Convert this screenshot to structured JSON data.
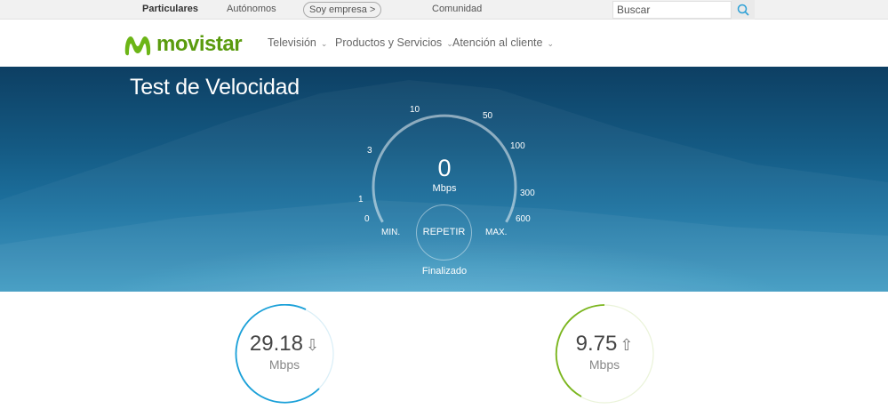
{
  "topbar": {
    "items": [
      "Particulares",
      "Autónomos",
      "Soy empresa >",
      "Comunidad"
    ],
    "search_placeholder": "Buscar"
  },
  "nav": {
    "brand": "movistar",
    "items": [
      "Televisión",
      "Productos y Servicios",
      "Atención al cliente"
    ]
  },
  "hero": {
    "title": "Test de Velocidad",
    "gauge_ticks": [
      "0",
      "1",
      "3",
      "10",
      "50",
      "100",
      "300",
      "600"
    ],
    "speed_value": "0",
    "speed_unit": "Mbps",
    "min_label": "MIN.",
    "max_label": "MAX.",
    "repeat_label": "REPETIR",
    "status": "Finalizado"
  },
  "results": {
    "download": {
      "value": "29.18",
      "unit": "Mbps",
      "icon": "download-arrow-icon",
      "color": "#1aa0d8"
    },
    "upload": {
      "value": "9.75",
      "unit": "Mbps",
      "icon": "upload-arrow-icon",
      "color": "#7ab51d"
    }
  },
  "colors": {
    "brand_green": "#5a9b0e",
    "hero_blue": "#145982"
  }
}
